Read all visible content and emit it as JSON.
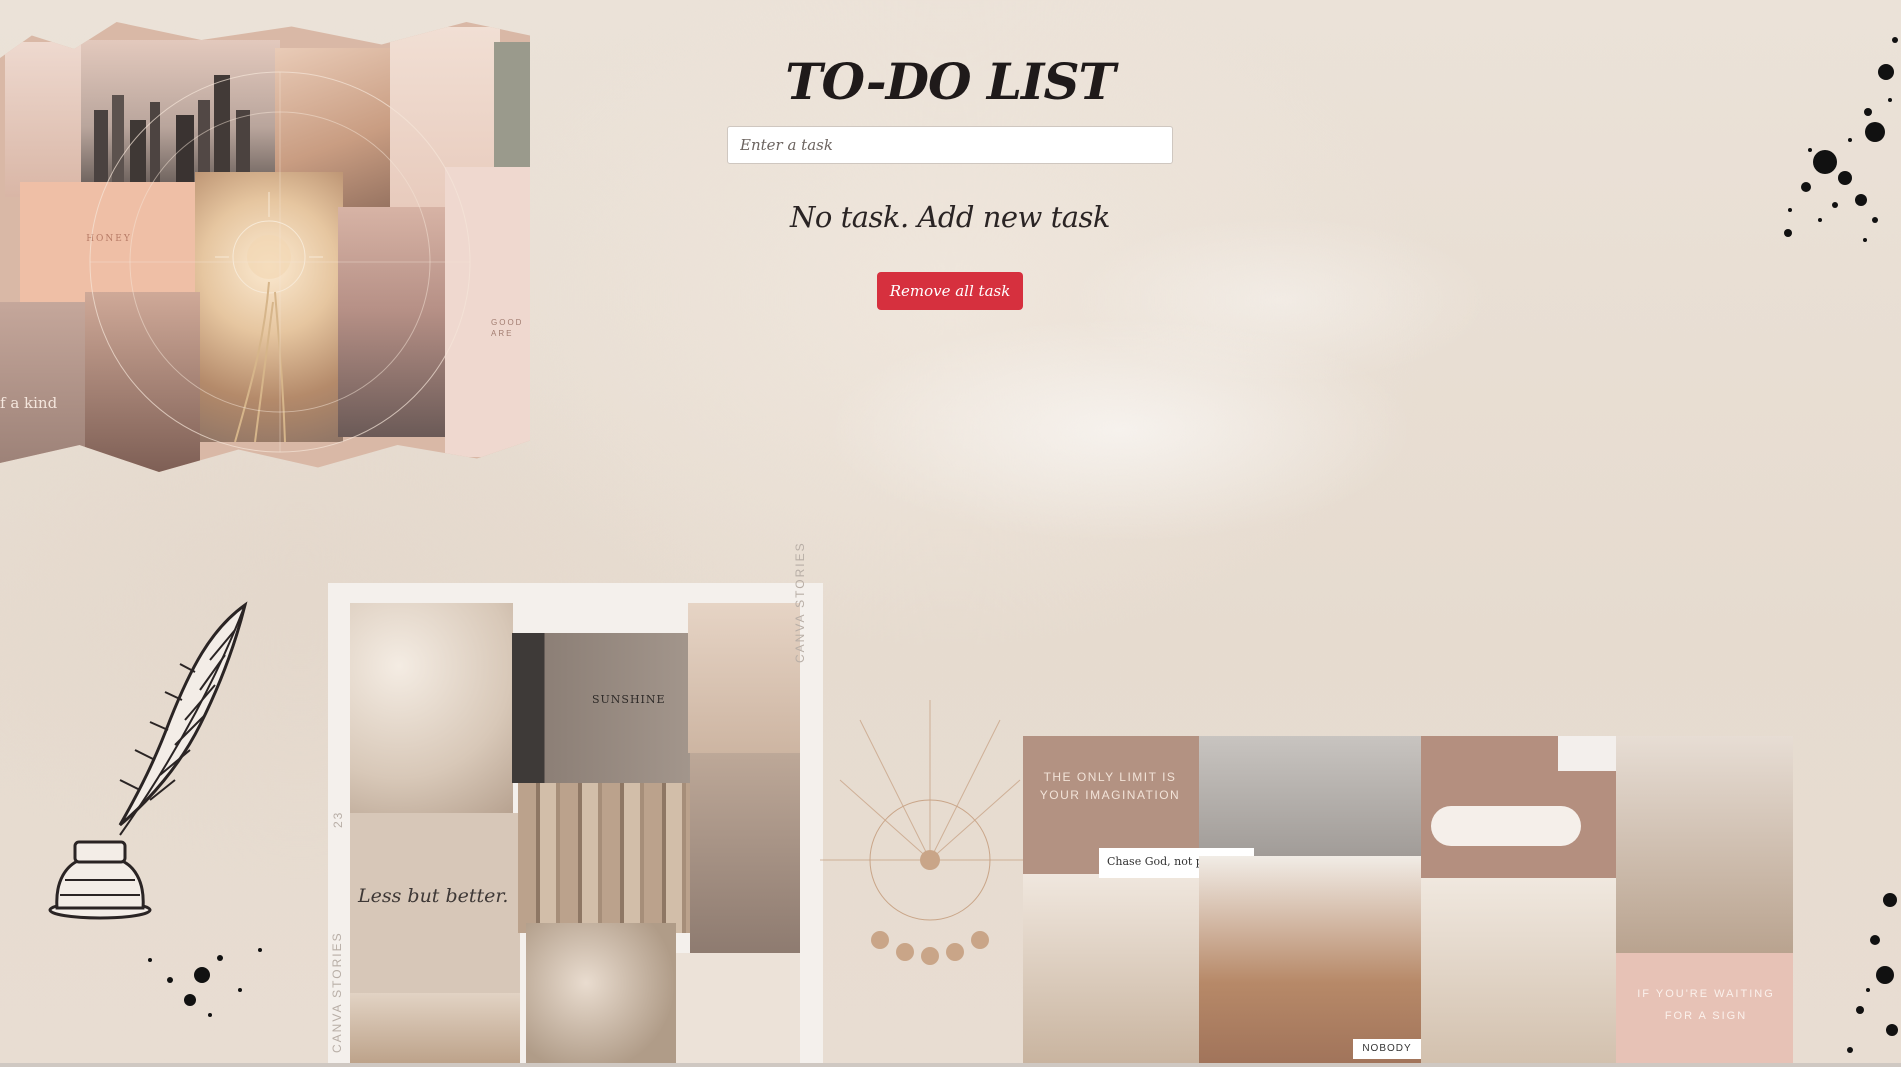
{
  "app": {
    "title": "TO-DO LIST",
    "input_placeholder": "Enter a task",
    "input_value": "",
    "empty_message": "No task. Add new task",
    "remove_all_label": "Remove all task"
  },
  "collage_text": {
    "honey": "HONEY",
    "good_are": "GOOD\nARE",
    "one_of_a_kind": "f a kind",
    "sunshine": "SUNSHINE",
    "less_but_better": "Less but better.",
    "canva_stories": "CANVA STORIES",
    "number_23": "23",
    "only_limit": "THE ONLY LIMIT IS YOUR IMAGINATION",
    "chase_god": "Chase God, not people.",
    "nobody": "NOBODY",
    "if_youre_waiting": "IF YOU'RE WAITING FOR A SIGN"
  },
  "colors": {
    "accent_button": "#d6303e",
    "title_text": "#1f1a1a",
    "background": "#e7ddd3"
  },
  "icons": {
    "feather": "quill-feather-icon",
    "inkwell": "inkwell-icon"
  }
}
